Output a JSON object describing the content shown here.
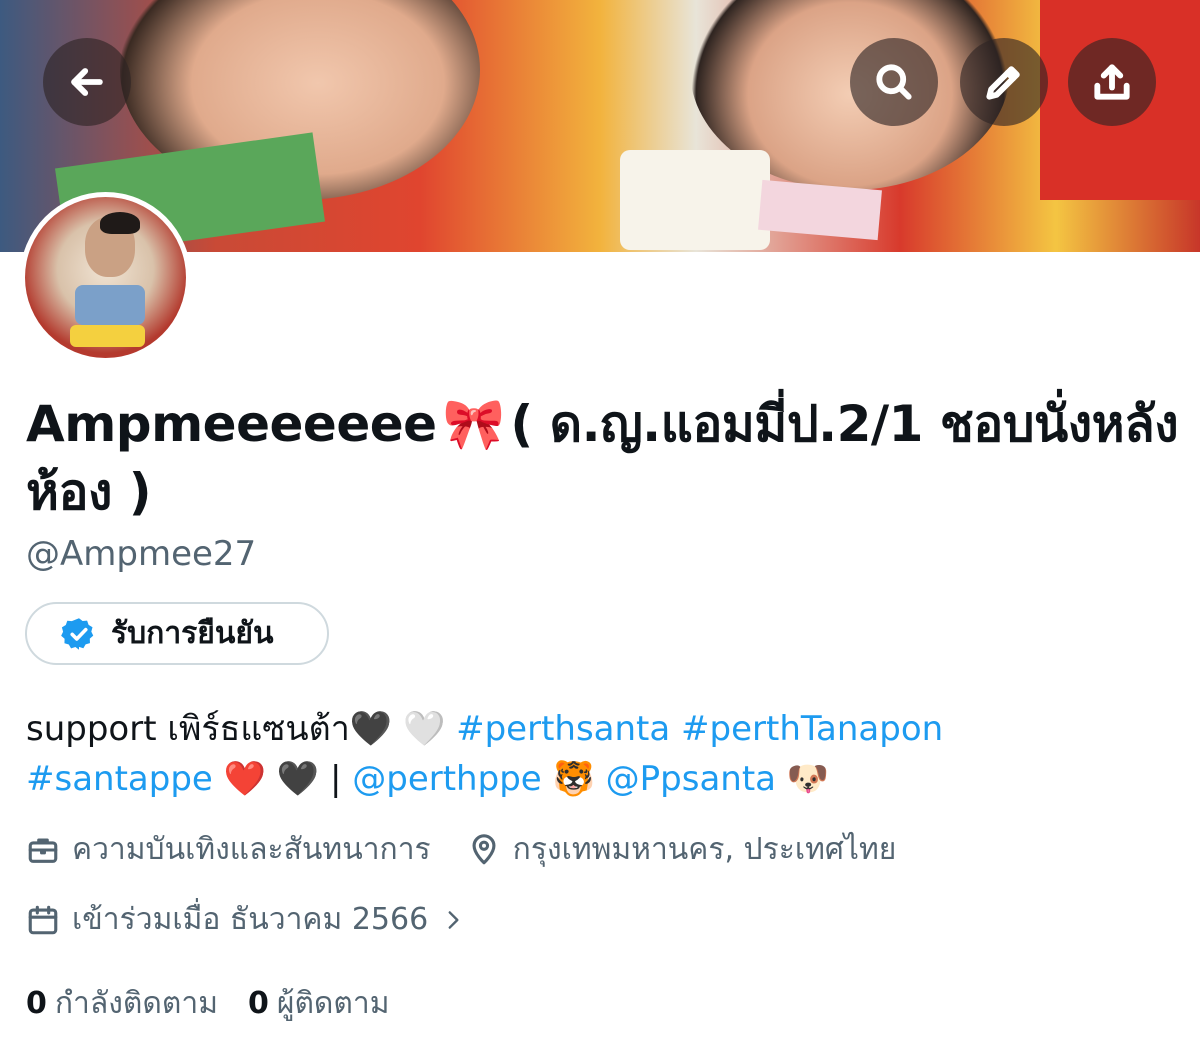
{
  "profile": {
    "display_name": "Ampmeeeeeee",
    "name_bow": "🎀",
    "name_suffix": "( ด.ญ.แอมมี่ป.2/1 ชอบนั่งหลังห้อง )",
    "handle": "@Ampmee27",
    "verify_label": "รับการยืนยัน",
    "bio": {
      "text_start": "support เพิร์ธแซนต้า",
      "heart_black_1": "🖤",
      "heart_white": "🤍",
      "tag_perthsanta": "#perthsanta",
      "tag_perthtanapon": "#perthTanapon",
      "tag_santappe": "#santappe",
      "heart_red": "❤️",
      "heart_black_2": "🖤",
      "separator": "|",
      "mention_perthppe": "@perthppe",
      "emoji_tiger": "🐯",
      "mention_ppsanta": "@Ppsanta",
      "emoji_dog": "🐶"
    },
    "category": "ความบันเทิงและสันทนาการ",
    "location": "กรุงเทพมหานคร, ประเทศไทย",
    "joined": "เข้าร่วมเมื่อ ธันวาคม 2566",
    "following_count": "0",
    "following_label": "กำลังติดตาม",
    "followers_count": "0",
    "followers_label": "ผู้ติดตาม"
  },
  "icons": {
    "back": "arrow-left-icon",
    "search": "search-icon",
    "edit": "pencil-icon",
    "share": "share-icon",
    "verified": "verified-badge-icon",
    "category": "briefcase-icon",
    "location": "location-pin-icon",
    "joined": "calendar-icon",
    "chevron": "chevron-right-icon"
  },
  "colors": {
    "link": "#1d9bf0",
    "secondary_text": "#536471",
    "verified": "#1d9bf0"
  }
}
